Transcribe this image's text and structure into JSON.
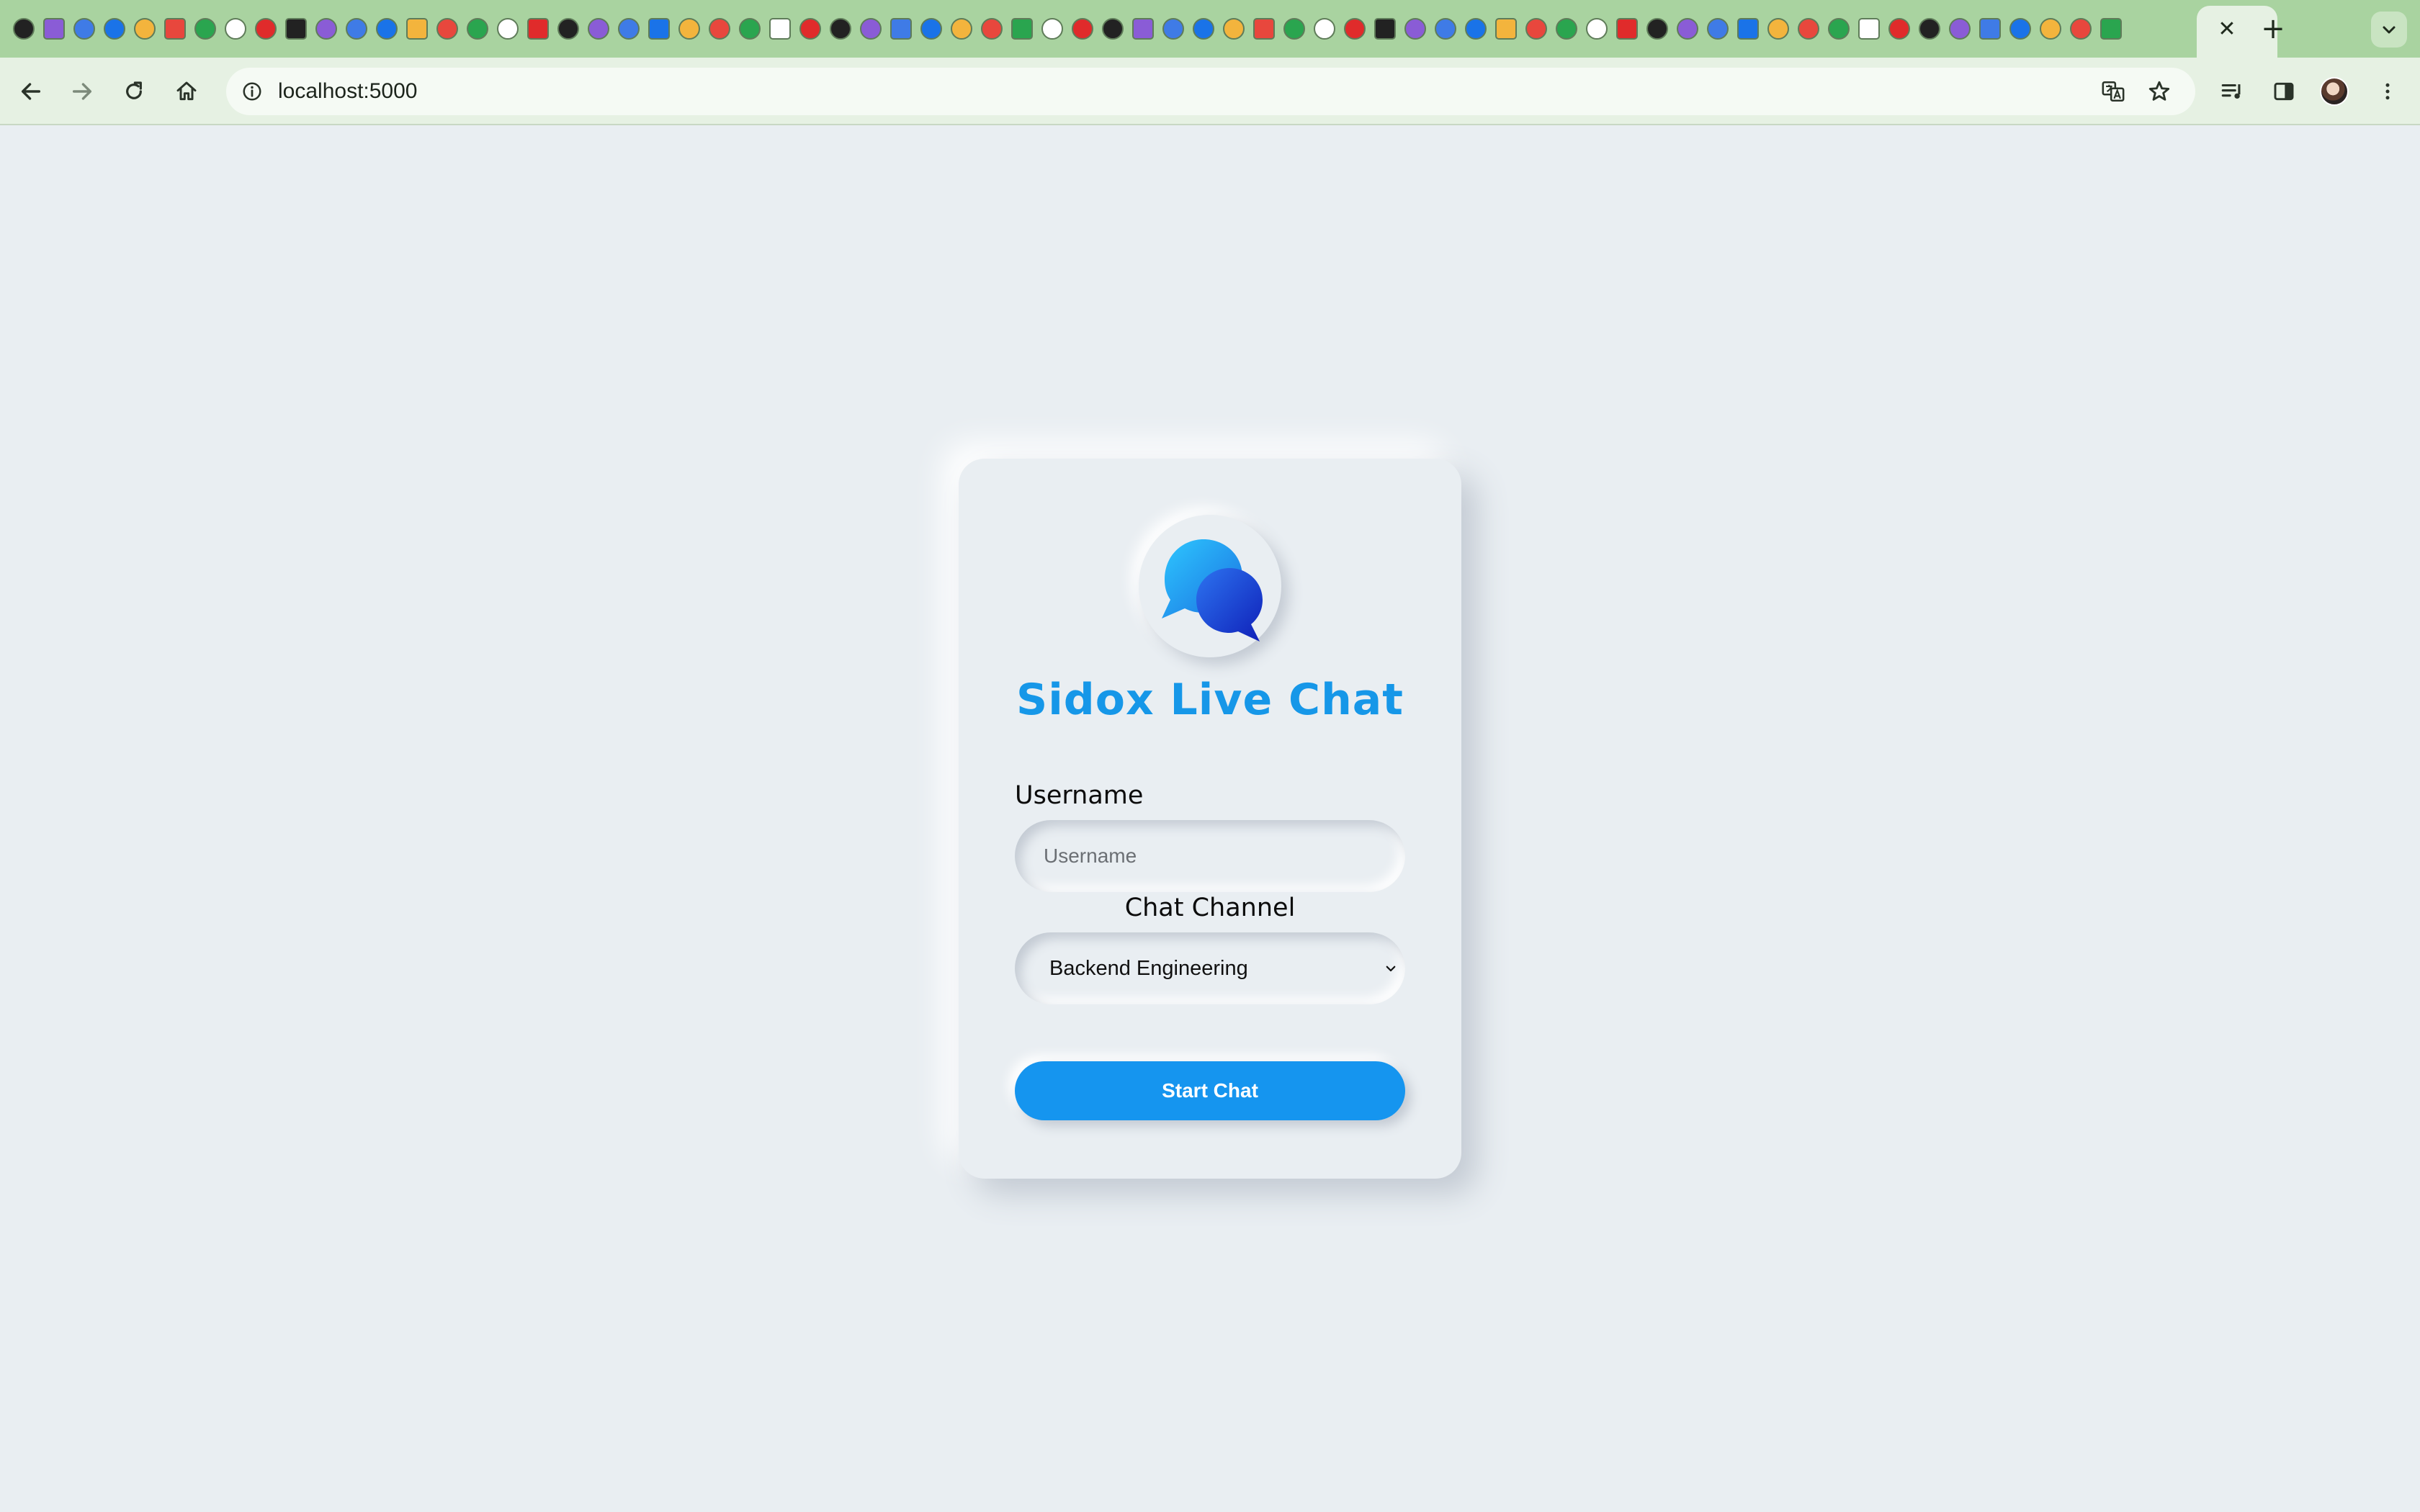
{
  "browser": {
    "address_url": "localhost:5000",
    "tab_close_glyph": "✕",
    "new_tab_glyph": "+"
  },
  "page": {
    "title": "Sidox Live Chat",
    "username_label": "Username",
    "username_placeholder": "Username",
    "username_value": "",
    "channel_label": "Chat Channel",
    "channel_selected": "Backend Engineering",
    "start_button_label": "Start Chat"
  },
  "colors": {
    "page_background": "#e9eef2",
    "accent": "#1595ef",
    "title_color": "#1697e8",
    "tabstrip": "#a9d3a0",
    "toolbar": "#e6f1e3"
  },
  "icons": {
    "back": "back-arrow-icon",
    "forward": "forward-arrow-icon",
    "reload": "reload-icon",
    "home": "home-icon",
    "site_info": "info-icon",
    "translate": "translate-icon",
    "bookmark": "star-icon",
    "media": "media-controls-icon",
    "side_panel": "side-panel-icon",
    "menu": "kebab-menu-icon",
    "logo": "chat-bubbles-icon",
    "caret": "chevron-down-icon"
  }
}
